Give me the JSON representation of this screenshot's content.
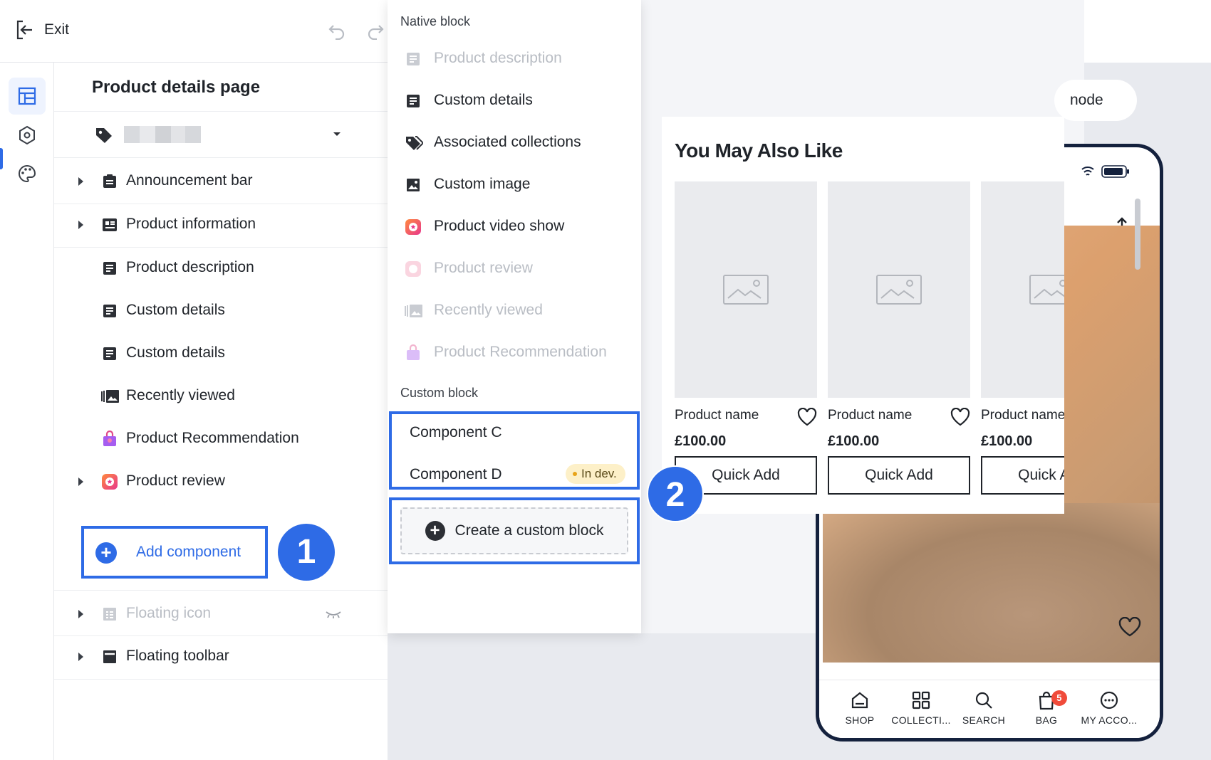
{
  "header": {
    "exit_label": "Exit"
  },
  "left_panel": {
    "title": "Product details page",
    "tree": [
      {
        "label": "Announcement bar",
        "icon": "list-clipboard-icon",
        "expandable": true
      },
      {
        "label": "Product information",
        "icon": "id-card-icon",
        "expandable": true
      },
      {
        "label": "Product description",
        "icon": "document-icon",
        "expandable": false
      },
      {
        "label": "Custom details",
        "icon": "document-icon",
        "expandable": false
      },
      {
        "label": "Custom details",
        "icon": "document-icon",
        "expandable": false
      },
      {
        "label": "Recently viewed",
        "icon": "gallery-icon",
        "expandable": false
      },
      {
        "label": "Product Recommendation",
        "icon": "gift-bag-icon",
        "expandable": false
      },
      {
        "label": "Product review",
        "icon": "review-app-icon",
        "expandable": true
      }
    ],
    "add_component_label": "Add component",
    "bottom_tree": [
      {
        "label": "Floating icon",
        "icon": "grid-window-icon",
        "hidden": true
      },
      {
        "label": "Floating toolbar",
        "icon": "toolbar-icon",
        "hidden": false
      }
    ]
  },
  "callouts": {
    "one": "1",
    "two": "2"
  },
  "block_menu": {
    "native_title": "Native block",
    "native_items": [
      {
        "label": "Product description",
        "icon": "document-icon",
        "disabled": true
      },
      {
        "label": "Custom details",
        "icon": "document-icon",
        "disabled": false
      },
      {
        "label": "Associated collections",
        "icon": "tags-icon",
        "disabled": false
      },
      {
        "label": "Custom image",
        "icon": "image-icon",
        "disabled": false
      },
      {
        "label": "Product video show",
        "icon": "video-app-icon",
        "disabled": false
      },
      {
        "label": "Product review",
        "icon": "review-app-icon",
        "disabled": true
      },
      {
        "label": "Recently viewed",
        "icon": "gallery-icon",
        "disabled": true
      },
      {
        "label": "Product Recommendation",
        "icon": "gift-bag-icon",
        "disabled": true
      }
    ],
    "custom_title": "Custom block",
    "custom_items": [
      {
        "label": "Component C"
      },
      {
        "label": "Component D",
        "badge": "In dev."
      }
    ],
    "create_label": "Create a custom block"
  },
  "preview": {
    "mode_label": "node",
    "section_title": "You May Also Like",
    "products": [
      {
        "name": "Product name",
        "price": "£100.00",
        "button": "Quick Add"
      },
      {
        "name": "Product name",
        "price": "£100.00",
        "button": "Quick Add"
      },
      {
        "name": "Product name",
        "price": "£100.00",
        "button": "Quick Add"
      }
    ],
    "phone_nav": [
      {
        "label": "SHOP",
        "icon": "home-icon"
      },
      {
        "label": "COLLECTI...",
        "icon": "grid-icon"
      },
      {
        "label": "SEARCH",
        "icon": "search-icon"
      },
      {
        "label": "BAG",
        "icon": "bag-icon",
        "badge": "5"
      },
      {
        "label": "MY ACCO...",
        "icon": "account-icon"
      }
    ]
  },
  "colors": {
    "accent": "#2e6be6",
    "badge_red": "#f04b3a",
    "indev_bg": "#fdf0c8"
  }
}
